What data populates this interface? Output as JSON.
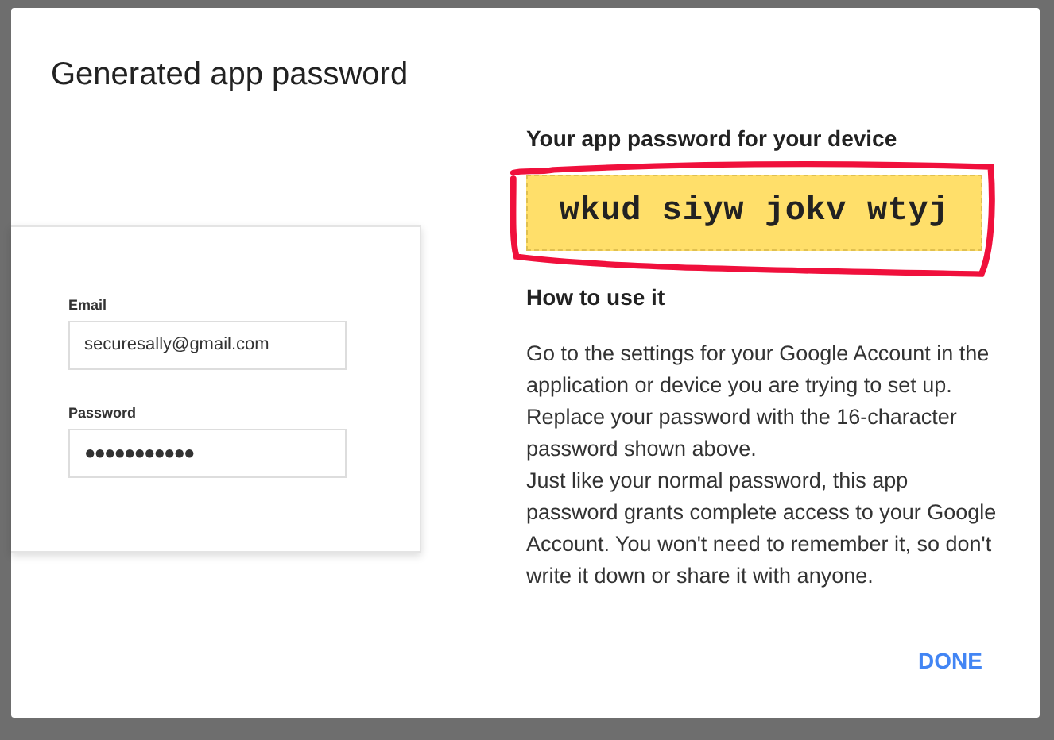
{
  "dialog": {
    "title": "Generated app password"
  },
  "sign_in_card": {
    "fields": [
      {
        "label": "Email",
        "value": "securesally@gmail.com"
      },
      {
        "label": "Password",
        "value": "●●●●●●●●●●●"
      }
    ]
  },
  "app_password": {
    "heading": "Your app password for your device",
    "password": "wkud siyw jokv wtyj"
  },
  "instructions": {
    "heading": "How to use it",
    "paragraphs": [
      "Go to the settings for your Google Account in the application or device you are trying to set up. Replace your password with the 16-character password shown above.",
      "Just like your normal password, this app password grants complete access to your Google Account. You won't need to remember it, so don't write it down or share it with anyone."
    ]
  },
  "buttons": [
    "DONE"
  ]
}
